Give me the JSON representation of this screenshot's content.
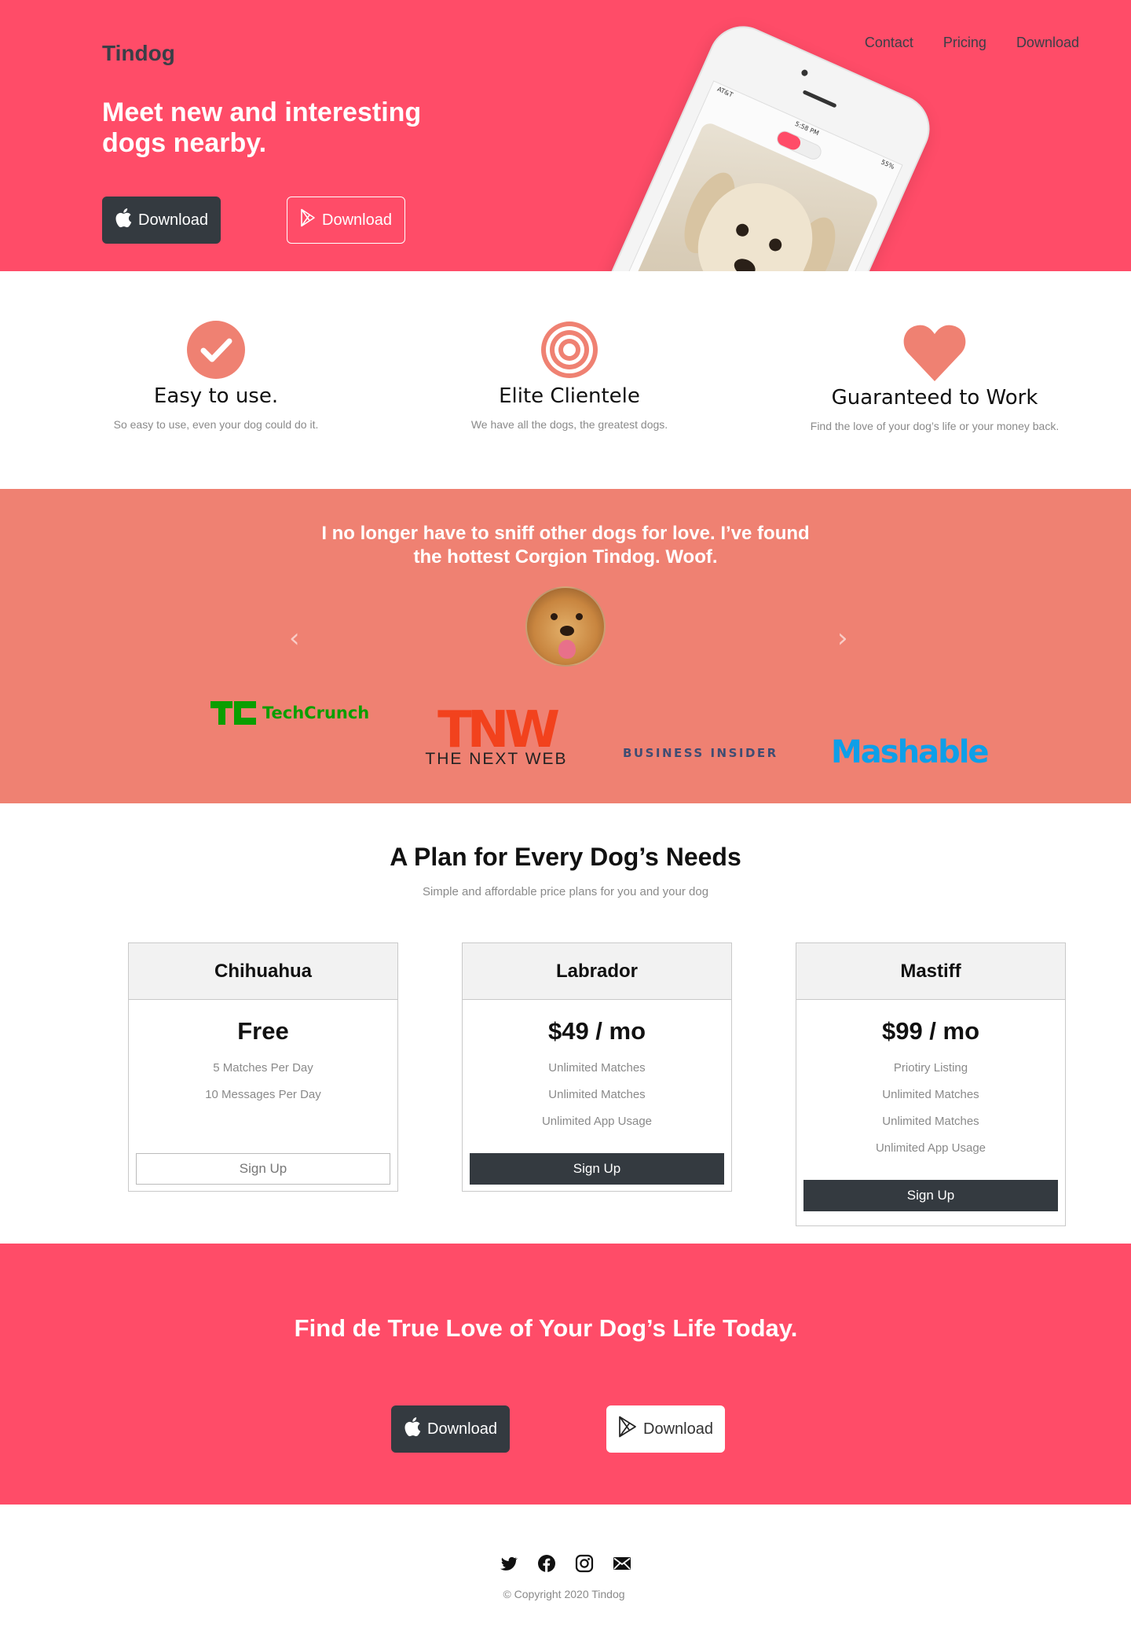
{
  "header": {
    "brand": "Tindog",
    "nav": [
      "Contact",
      "Pricing",
      "Download"
    ],
    "title": "Meet new and interesting dogs nearby.",
    "apple_download": "Download",
    "play_download": "Download"
  },
  "phone": {
    "carrier": "AT&T",
    "time": "5:58 PM",
    "battery": "55%"
  },
  "features": [
    {
      "icon": "check-circle-icon",
      "title": "Easy to use.",
      "desc": "So easy to use, even your dog could do it."
    },
    {
      "icon": "bullseye-icon",
      "title": "Elite Clientele",
      "desc": "We have all the dogs, the greatest dogs."
    },
    {
      "icon": "heart-icon",
      "title": "Guaranteed to Work",
      "desc": "Find the love of your dog’s life or your money back."
    }
  ],
  "testimonial": {
    "quote": "I no longer have to sniff other dogs for love. I’ve found the hottest Corgion Tindog. Woof.",
    "prev": "‹",
    "next": "›"
  },
  "press": {
    "techcrunch": "TechCrunch",
    "tnw_logo": "TNW",
    "tnw_text": "THE NEXT WEB",
    "business_insider": "BUSINESS INSIDER",
    "mashable": "Mashable"
  },
  "pricing": {
    "title": "A Plan for Every Dog’s Needs",
    "subtitle": "Simple and affordable price plans for you and your dog",
    "plans": [
      {
        "name": "Chihuahua",
        "price": "Free",
        "features": [
          "5 Matches Per Day",
          "10 Messages Per Day"
        ],
        "button": "Sign Up"
      },
      {
        "name": "Labrador",
        "price": "$49 / mo",
        "features": [
          "Unlimited Matches",
          "Unlimited Matches",
          "Unlimited App Usage"
        ],
        "button": "Sign Up"
      },
      {
        "name": "Mastiff",
        "price": "$99 / mo",
        "features": [
          "Priotiry Listing",
          "Unlimited Matches",
          "Unlimited Matches",
          "Unlimited App Usage"
        ],
        "button": "Sign Up"
      }
    ]
  },
  "cta": {
    "title": "Find de True Love of Your Dog’s Life Today.",
    "apple_download": "Download",
    "play_download": "Download"
  },
  "footer": {
    "socials": [
      "twitter-icon",
      "facebook-icon",
      "instagram-icon",
      "envelope-icon"
    ],
    "copyright": "© Copyright 2020 Tindog"
  },
  "colors": {
    "hero": "#ff4c68",
    "coral": "#ef8172",
    "dark": "#343a40"
  }
}
